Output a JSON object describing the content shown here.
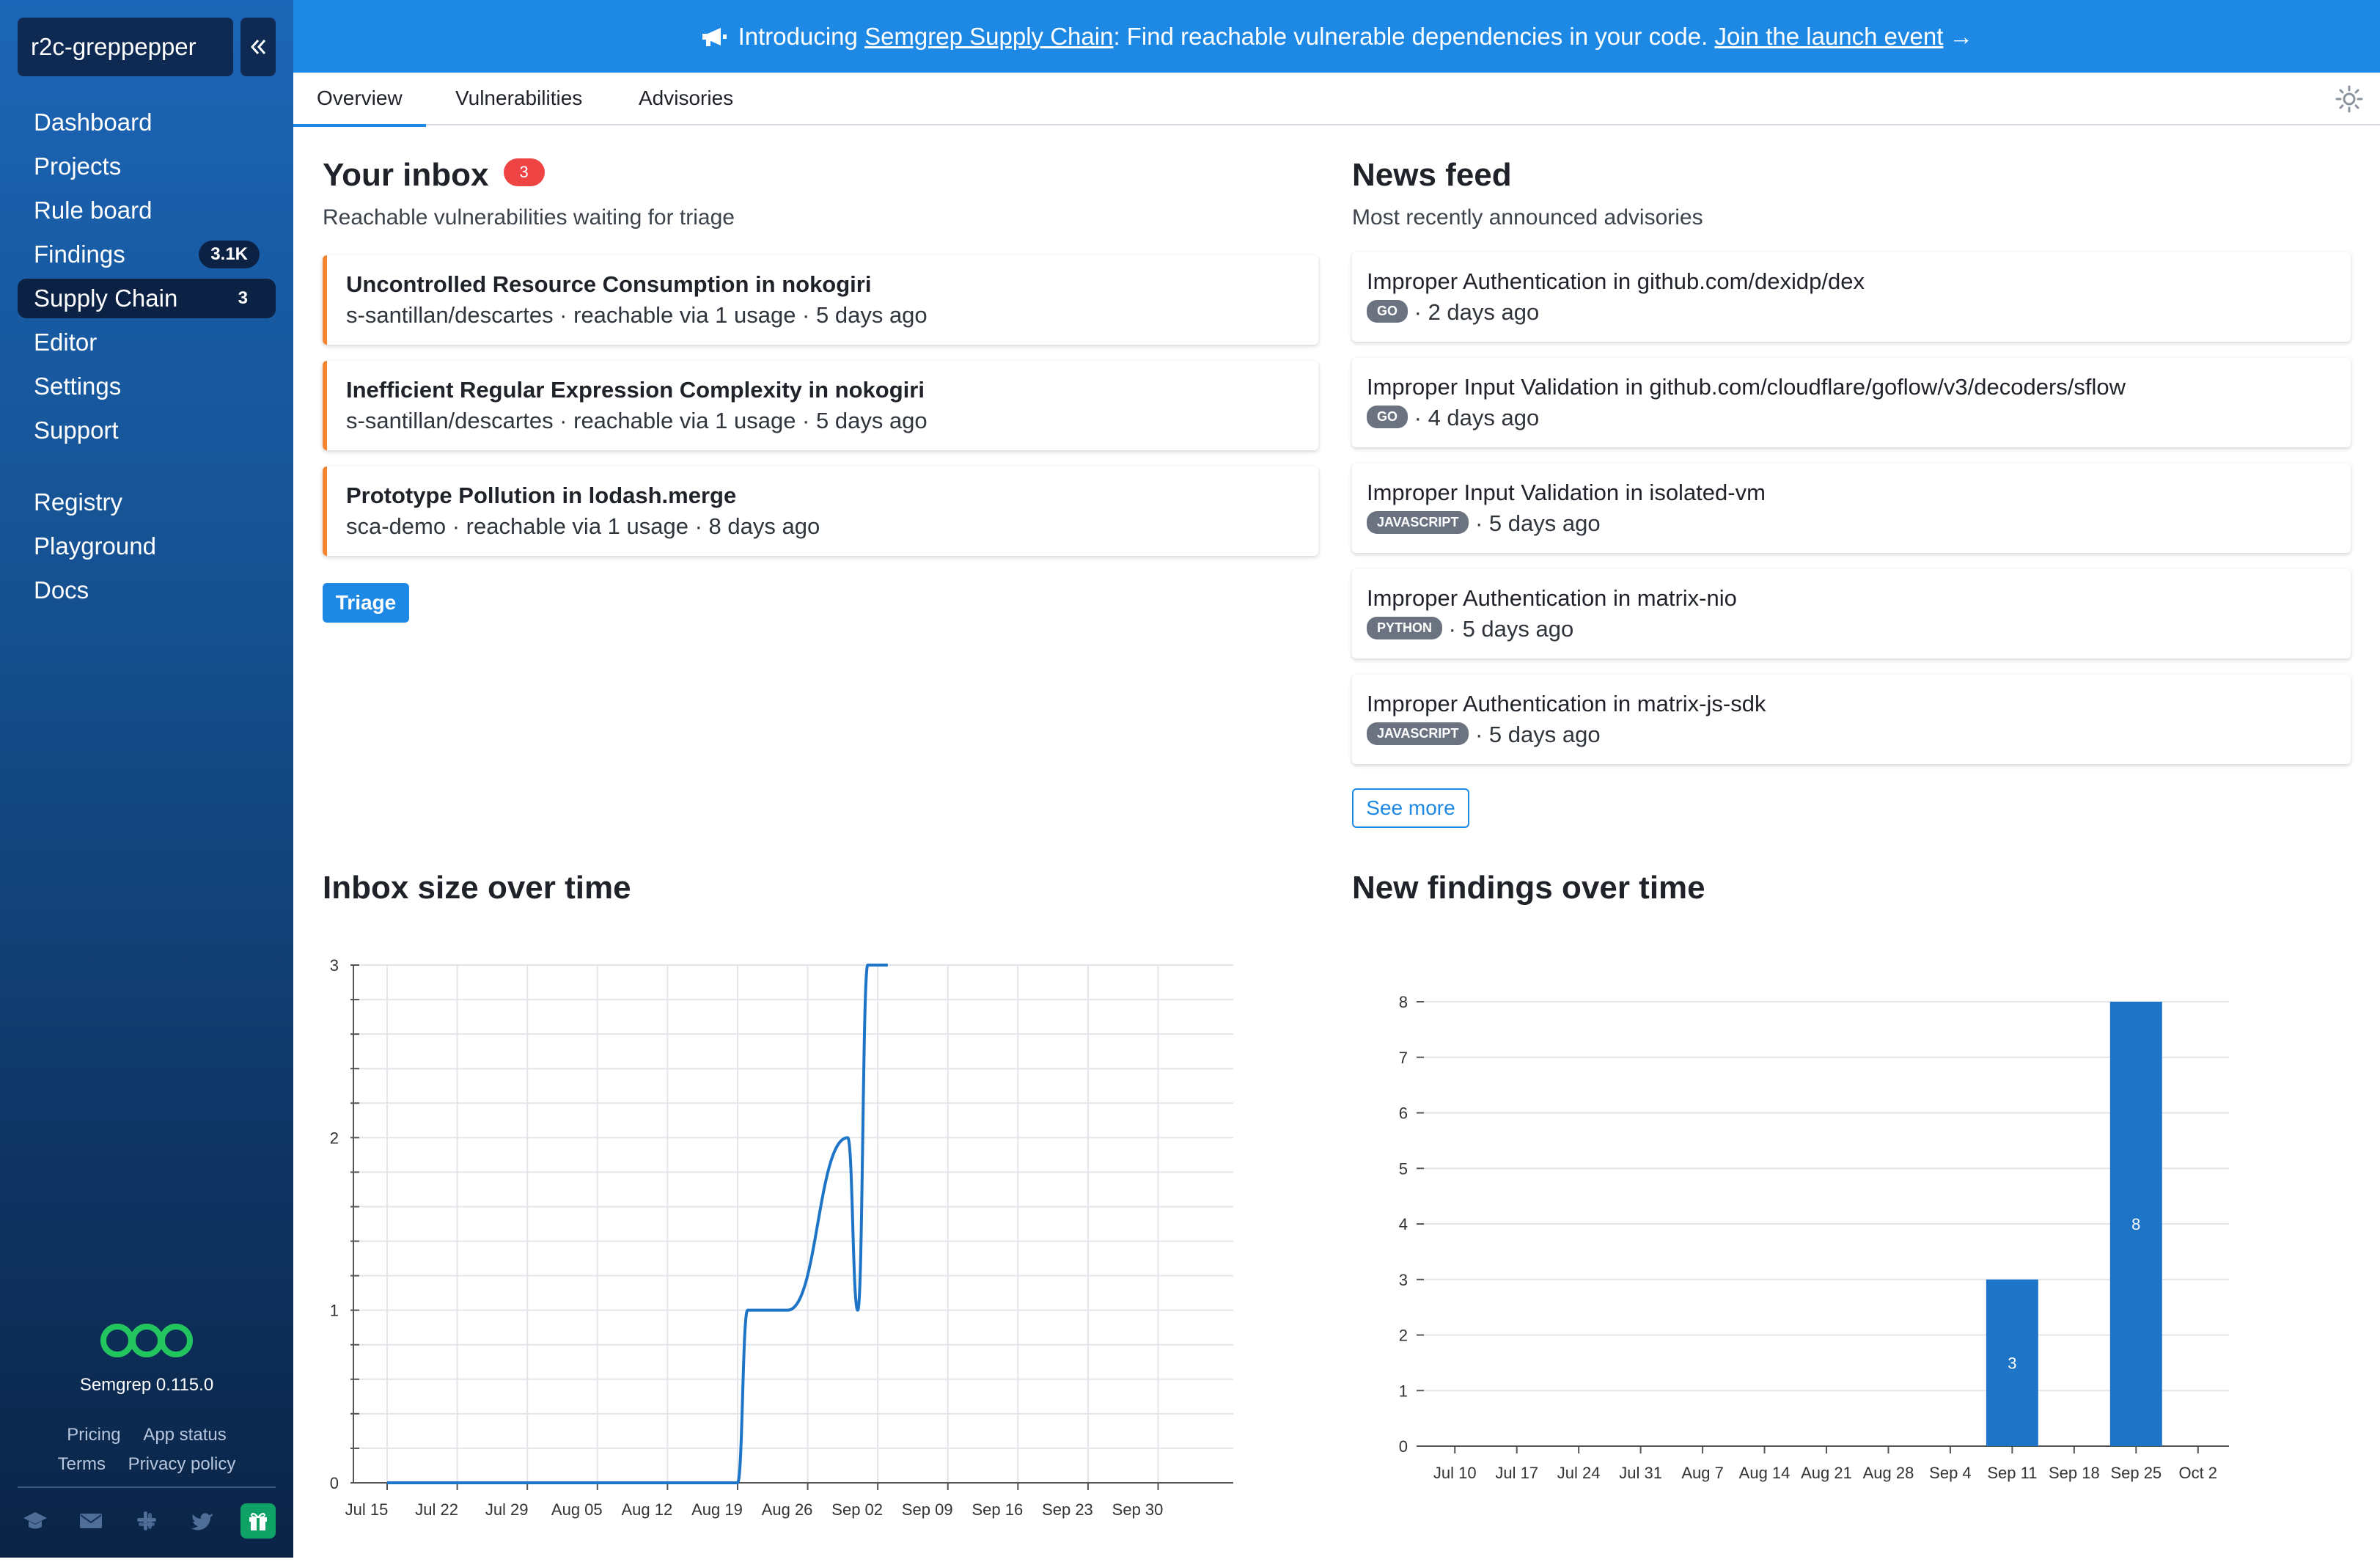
{
  "sidebar": {
    "org": "r2c-greppepper",
    "nav": [
      {
        "label": "Dashboard",
        "badge": ""
      },
      {
        "label": "Projects",
        "badge": ""
      },
      {
        "label": "Rule board",
        "badge": ""
      },
      {
        "label": "Findings",
        "badge": "3.1K"
      },
      {
        "label": "Supply Chain",
        "badge": "3",
        "active": true
      },
      {
        "label": "Editor",
        "badge": ""
      },
      {
        "label": "Settings",
        "badge": ""
      },
      {
        "label": "Support",
        "badge": ""
      }
    ],
    "nav2": [
      {
        "label": "Registry"
      },
      {
        "label": "Playground"
      },
      {
        "label": "Docs"
      }
    ],
    "version": "Semgrep 0.115.0",
    "footer_links": [
      "Pricing",
      "App status",
      "Terms",
      "Privacy policy"
    ],
    "footer_icons": [
      "graduation-cap-icon",
      "envelope-icon",
      "slack-icon",
      "twitter-icon",
      "gift-icon"
    ]
  },
  "banner": {
    "prefix": "Introducing ",
    "link1": "Semgrep Supply Chain",
    "middle": ": Find reachable vulnerable dependencies in your code. ",
    "link2": "Join the launch event",
    "arrow": "→"
  },
  "tabs": [
    "Overview",
    "Vulnerabilities",
    "Advisories"
  ],
  "inbox": {
    "title": "Your inbox",
    "count": "3",
    "subtitle": "Reachable vulnerabilities waiting for triage",
    "items": [
      {
        "title": "Uncontrolled Resource Consumption in nokogiri",
        "meta": "s-santillan/descartes · reachable via 1 usage · 5 days ago"
      },
      {
        "title": "Inefficient Regular Expression Complexity in nokogiri",
        "meta": "s-santillan/descartes · reachable via 1 usage · 5 days ago"
      },
      {
        "title": "Prototype Pollution in lodash.merge",
        "meta": "sca-demo · reachable via 1 usage · 8 days ago"
      }
    ],
    "button": "Triage"
  },
  "news": {
    "title": "News feed",
    "subtitle": "Most recently announced advisories",
    "items": [
      {
        "title": "Improper Authentication in github.com/dexidp/dex",
        "lang": "GO",
        "age": "· 2 days ago"
      },
      {
        "title": "Improper Input Validation in github.com/cloudflare/goflow/v3/decoders/sflow",
        "lang": "GO",
        "age": "· 4 days ago"
      },
      {
        "title": "Improper Input Validation in isolated-vm",
        "lang": "JAVASCRIPT",
        "age": "· 5 days ago"
      },
      {
        "title": "Improper Authentication in matrix-nio",
        "lang": "PYTHON",
        "age": "· 5 days ago"
      },
      {
        "title": "Improper Authentication in matrix-js-sdk",
        "lang": "JAVASCRIPT",
        "age": "· 5 days ago"
      }
    ],
    "button": "See more"
  },
  "chart_data": [
    {
      "type": "line",
      "title": "Inbox size over time",
      "x_ticks": [
        "Jul 15",
        "Jul 22",
        "Jul 29",
        "Aug 05",
        "Aug 12",
        "Aug 19",
        "Aug 26",
        "Sep 02",
        "Sep 09",
        "Sep 16",
        "Sep 23",
        "Sep 30"
      ],
      "y_ticks": [
        0,
        1,
        2,
        3
      ],
      "ylim": [
        0,
        3
      ],
      "series": [
        {
          "points": [
            [
              "Jul 15",
              0
            ],
            [
              "Aug 19",
              0
            ],
            [
              "Aug 20",
              1
            ],
            [
              "Aug 24",
              1
            ],
            [
              "Aug 30",
              2
            ],
            [
              "Aug 31",
              1
            ],
            [
              "Sep 01",
              3
            ],
            [
              "Sep 03",
              3
            ]
          ]
        }
      ],
      "grid": true
    },
    {
      "type": "bar",
      "title": "New findings over time",
      "categories": [
        "Jul 10",
        "Jul 17",
        "Jul 24",
        "Jul 31",
        "Aug 7",
        "Aug 14",
        "Aug 21",
        "Aug 28",
        "Sep 4",
        "Sep 11",
        "Sep 18",
        "Sep 25",
        "Oct 2"
      ],
      "values": [
        0,
        0,
        0,
        0,
        0,
        0,
        0,
        0,
        0,
        3,
        0,
        8,
        0
      ],
      "y_ticks": [
        0,
        1,
        2,
        3,
        4,
        5,
        6,
        7,
        8
      ],
      "ylim": [
        0,
        8
      ],
      "color": "#1e74c6",
      "grid": true
    }
  ]
}
